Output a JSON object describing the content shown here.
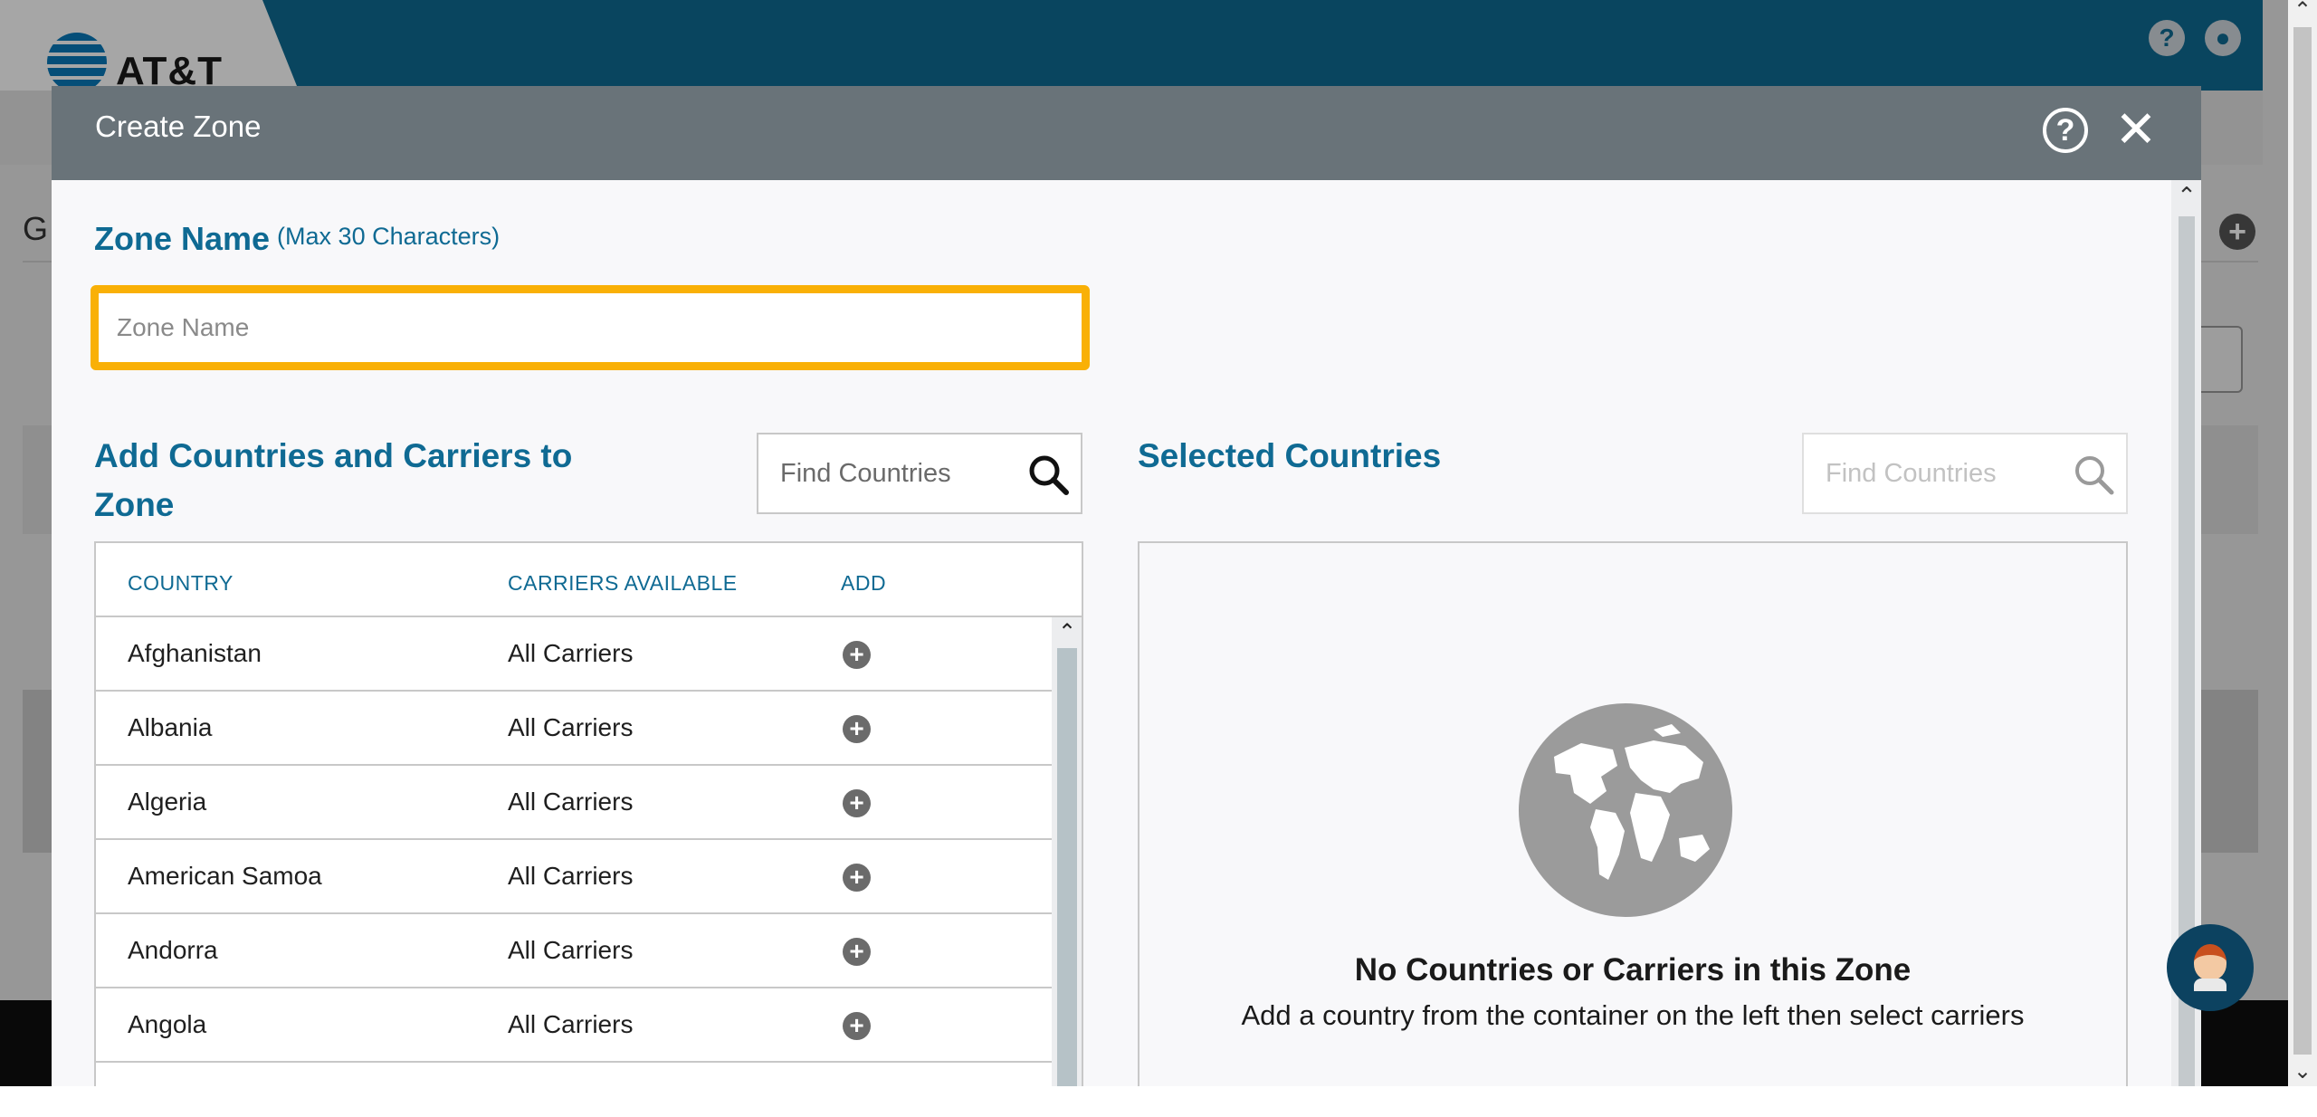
{
  "app": {
    "brand": "AT&T",
    "background_letter": "G",
    "colors": {
      "header": "#0f6a93",
      "accent": "#0f6a93",
      "highlight": "#f9b006",
      "modal_header": "#697379"
    }
  },
  "modal": {
    "title": "Create Zone",
    "zone_name": {
      "label": "Zone Name",
      "hint": "(Max 30 Characters)",
      "placeholder": "Zone Name",
      "value": ""
    },
    "add_section": {
      "title": "Add Countries and Carriers to Zone",
      "search_placeholder": "Find Countries",
      "columns": [
        "COUNTRY",
        "CARRIERS AVAILABLE",
        "ADD"
      ],
      "rows": [
        {
          "country": "Afghanistan",
          "carriers": "All Carriers"
        },
        {
          "country": "Albania",
          "carriers": "All Carriers"
        },
        {
          "country": "Algeria",
          "carriers": "All Carriers"
        },
        {
          "country": "American Samoa",
          "carriers": "All Carriers"
        },
        {
          "country": "Andorra",
          "carriers": "All Carriers"
        },
        {
          "country": "Angola",
          "carriers": "All Carriers"
        },
        {
          "country": "",
          "carriers": ""
        }
      ]
    },
    "selected_section": {
      "title": "Selected Countries",
      "search_placeholder": "Find Countries",
      "empty_title": "No Countries or Carriers in this Zone",
      "empty_subtitle": "Add a country from the container on the left then select carriers",
      "empty_icon": "globe-icon"
    }
  }
}
